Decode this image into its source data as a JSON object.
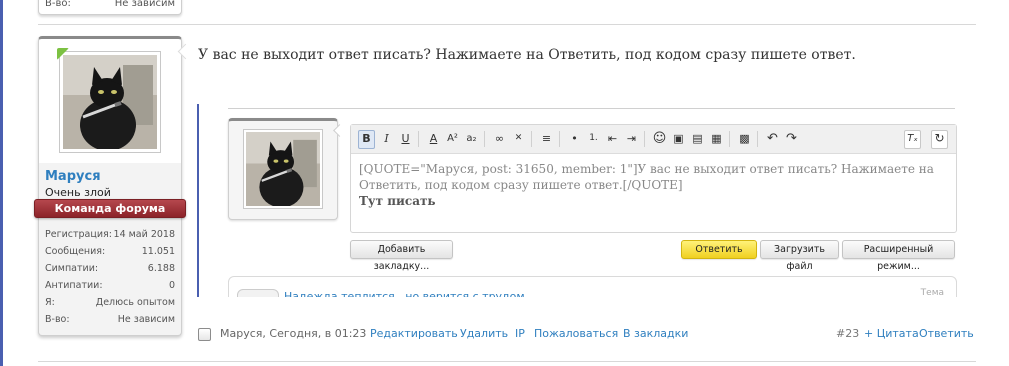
{
  "prev_user": {
    "stat_key": "В-во:",
    "stat_value": "Не зависим"
  },
  "user": {
    "name": "Маруся",
    "title": "Очень злой модератор!",
    "badge": "Команда форума",
    "stats": [
      {
        "k": "Регистрация:",
        "v": "14 май 2018"
      },
      {
        "k": "Сообщения:",
        "v": "11.051"
      },
      {
        "k": "Симпатии:",
        "v": "6.188"
      },
      {
        "k": "Антипатии:",
        "v": "0"
      },
      {
        "k": "Я:",
        "v": "Делюсь опытом"
      },
      {
        "k": "В-во:",
        "v": "Не зависим"
      }
    ]
  },
  "post": {
    "message": "У вас не выходит ответ писать? Нажимаете на Ответить, под кодом сразу пишете ответ."
  },
  "editor": {
    "toolbar": [
      "B",
      "I",
      "U",
      "A",
      "A²",
      "a₂",
      "∞",
      "✕",
      "≡",
      "•",
      "1.",
      "⇤",
      "⇥",
      "☺",
      "▣",
      "▤",
      "▦",
      "↶",
      "↷",
      "Tₓ",
      "↻"
    ],
    "quote_text": "[QUOTE=\"Маруся, post: 31650, member: 1\"]У вас не выходит ответ писать? Нажимаете на Ответить, под кодом сразу пишете ответ.[/QUOTE]",
    "content_text": "Тут писать",
    "buttons": {
      "bookmark": "Добавить закладку...",
      "reply": "Ответить",
      "upload": "Загрузить файл",
      "advanced": "Расширенный режим..."
    }
  },
  "related": {
    "title": "Надежда теплится , но верится с трудом",
    "type": "Тема"
  },
  "footer": {
    "meta": "Маруся, Сегодня, в 01:23",
    "edit": "Редактировать",
    "delete": "Удалить",
    "ip": "IP",
    "report": "Пожаловаться",
    "bookmarks": "В закладки",
    "post_number": "#23",
    "quote": "+ Цитата",
    "reply": "Ответить"
  },
  "colors": {
    "accent": "#2f7fbf",
    "badge": "#9b2f35",
    "quote_bar": "#4a5fb0",
    "online": "#7cc142"
  }
}
